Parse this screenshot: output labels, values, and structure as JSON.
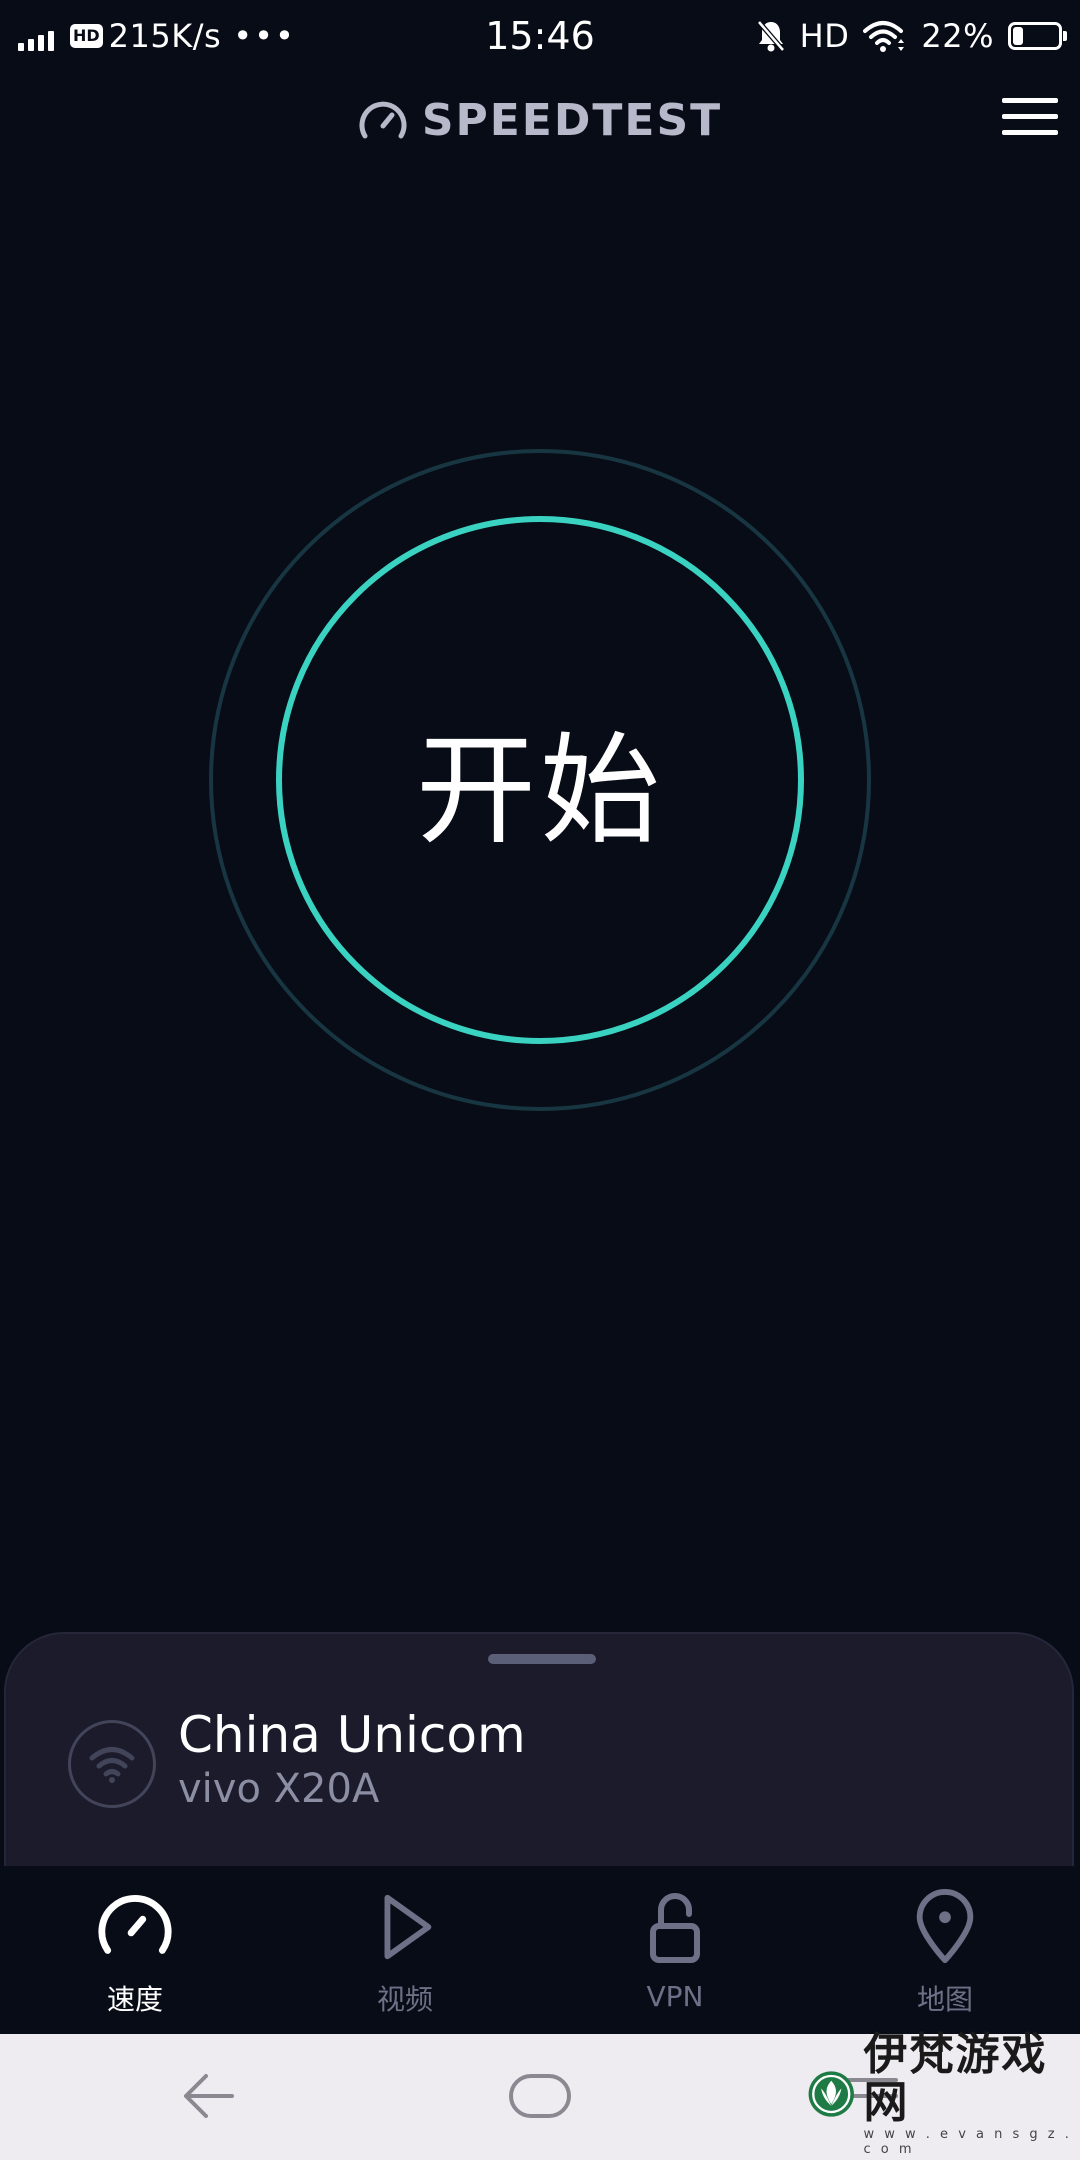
{
  "status_bar": {
    "hd_badge": "HD",
    "speed": "215K/s",
    "dots": "•••",
    "time": "15:46",
    "hd_right": "HD",
    "battery": "22%",
    "battery_level": 0.22
  },
  "header": {
    "brand": "SPEEDTEST",
    "menu_icon": "hamburger-menu-icon"
  },
  "gauge": {
    "start_label": "开始",
    "accent_color": "#3ad3c2",
    "outer_ring_color": "#173642"
  },
  "connection": {
    "isp": "China Unicom",
    "device": "vivo X20A",
    "icon": "wifi-icon"
  },
  "tabs": [
    {
      "label": "速度",
      "icon": "speedometer-icon",
      "active": true
    },
    {
      "label": "视频",
      "icon": "play-icon",
      "active": false
    },
    {
      "label": "VPN",
      "icon": "unlock-icon",
      "active": false
    },
    {
      "label": "地图",
      "icon": "map-pin-icon",
      "active": false
    }
  ],
  "watermark": {
    "title": "伊梵游戏网",
    "url": "w w w . e v a n s g z . c o m"
  }
}
